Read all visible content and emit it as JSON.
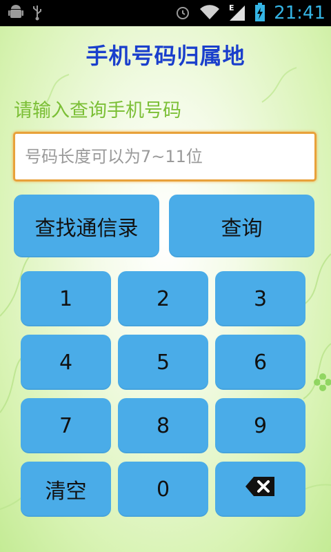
{
  "status_bar": {
    "time": "21:41",
    "left_icons": [
      "android-icon",
      "usb-icon"
    ],
    "right_icons": [
      "alarm-icon",
      "wifi-icon",
      "signal-icon",
      "battery-icon"
    ],
    "network_type": "E"
  },
  "app": {
    "title": "手机号码归属地"
  },
  "form": {
    "label": "请输入查询手机号码",
    "placeholder": "号码长度可以为7~11位",
    "value": ""
  },
  "actions": {
    "contacts_label": "查找通信录",
    "query_label": "查询"
  },
  "keypad": {
    "keys": [
      "1",
      "2",
      "3",
      "4",
      "5",
      "6",
      "7",
      "8",
      "9",
      "清空",
      "0"
    ],
    "backspace_icon": "backspace-icon"
  },
  "colors": {
    "title": "#1a3fcc",
    "label": "#7bbf36",
    "button": "#4aace8",
    "input_border": "#e8a13a",
    "status_time": "#35b5e5"
  }
}
